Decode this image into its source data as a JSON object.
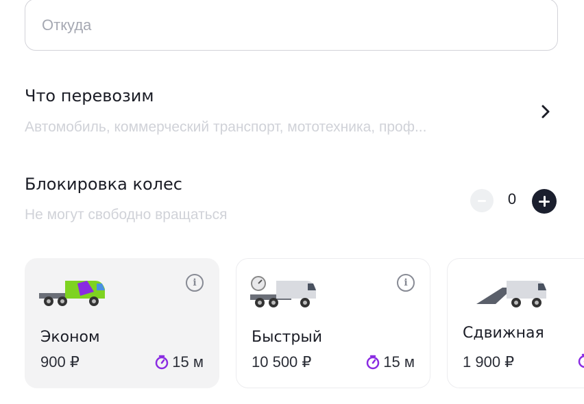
{
  "from": {
    "placeholder": "Откуда"
  },
  "cargo": {
    "title": "Что перевозим",
    "subtitle": "Автомобиль, коммерческий транспорт, мототехника, проф..."
  },
  "wheel_lock": {
    "title": "Блокировка колес",
    "subtitle": "Не могут свободно вращаться",
    "count": "0"
  },
  "tariffs": [
    {
      "name": "Эконом",
      "price": "900 ₽",
      "time": "15 м",
      "selected": true
    },
    {
      "name": "Быстрый",
      "price": "10 500 ₽",
      "time": "15 м",
      "selected": false
    },
    {
      "name": "Сдвижная",
      "price": "1 900 ₽",
      "time": "",
      "selected": false
    }
  ],
  "icons": {
    "chevron": "chevron-right-icon",
    "info": "info-icon",
    "timer": "timer-icon",
    "minus": "minus-icon",
    "plus": "plus-icon"
  },
  "colors": {
    "accent": "#8a2be2",
    "text": "#1b1d26",
    "muted": "#d0d2d8",
    "plus_button": "#1b1f2e",
    "selected_card": "#f3f3f4"
  }
}
